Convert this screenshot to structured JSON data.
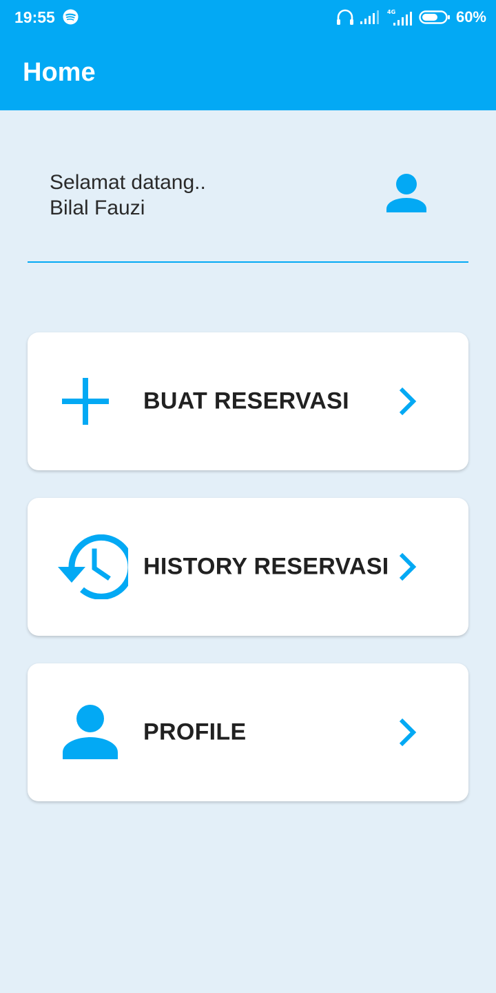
{
  "status_bar": {
    "time": "19:55",
    "battery": "60%",
    "network": "4G",
    "icons": [
      "spotify-icon",
      "headphones-icon",
      "signal-icon",
      "signal-4g-icon",
      "battery-icon"
    ]
  },
  "app_bar": {
    "title": "Home",
    "color": "#03a9f4"
  },
  "welcome": {
    "greeting": "Selamat datang..",
    "name": "Bilal Fauzi",
    "icon": "person-icon"
  },
  "menu": [
    {
      "label": "BUAT RESERVASI",
      "icon": "plus-icon"
    },
    {
      "label": "HISTORY RESERVASI",
      "icon": "history-icon"
    },
    {
      "label": "PROFILE",
      "icon": "person-icon"
    }
  ],
  "colors": {
    "accent": "#03a9f4",
    "background": "#e3eff8",
    "card": "#ffffff",
    "text": "#212121"
  }
}
